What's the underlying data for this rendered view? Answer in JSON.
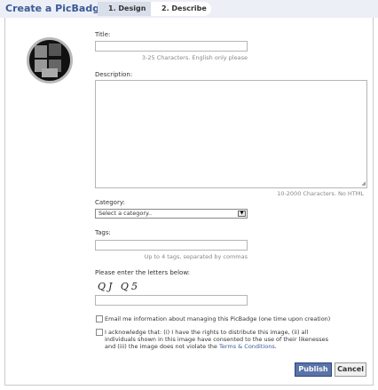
{
  "header": {
    "title": "Create a PicBadge",
    "steps": [
      {
        "label": "1. Design",
        "active": false
      },
      {
        "label": "2. Describe",
        "active": true
      }
    ]
  },
  "form": {
    "title_label": "Title:",
    "title_value": "",
    "title_hint": "3-25 Characters. English only please",
    "description_label": "Description:",
    "description_value": "",
    "description_hint": "10-2000 Characters. No HTML",
    "category_label": "Category:",
    "category_selected": "Select a category..",
    "tags_label": "Tags:",
    "tags_value": "",
    "tags_hint": "Up to 4 tags, separated by commas",
    "captcha_label": "Please enter the letters below:",
    "captcha_text": "QJ Q5",
    "captcha_value": "",
    "email_opt_text": "Email me information about managing this PicBadge (one time upon creation)",
    "ack_text": "I acknowledge that: (i) I have the rights to distribute this image, (ii) all individuals shown in this image have consented to the use of their likenesses and (iii) the image does not violate the",
    "ack_link": "Terms & Conditions",
    "ack_end": "."
  },
  "buttons": {
    "publish": "Publish",
    "cancel": "Cancel"
  },
  "colors": {
    "brand": "#3b5998",
    "publish_bg": "#5b74a8"
  }
}
